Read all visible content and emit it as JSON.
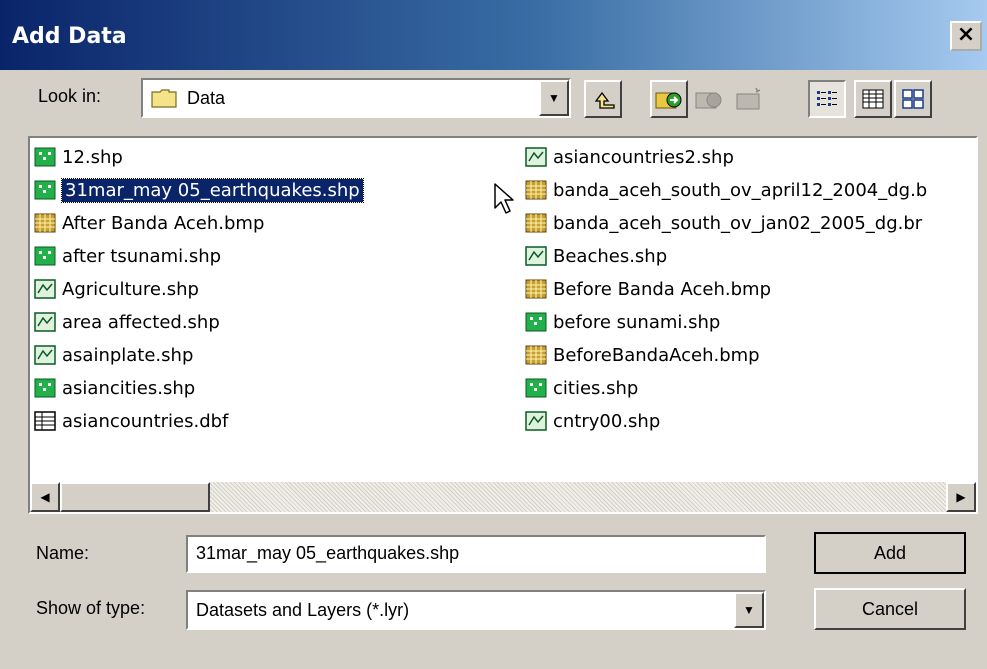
{
  "window": {
    "title": "Add Data",
    "close_label": "×"
  },
  "toolbar": {
    "lookin_label": "Look in:",
    "lookin_value": "Data",
    "icons": [
      "up-one-level-icon",
      "connect-to-folder-icon",
      "disconnect-folder-icon",
      "new-folder-icon",
      "list-view-icon",
      "details-view-icon",
      "thumbnails-view-icon"
    ]
  },
  "files": {
    "column1": [
      {
        "name": "12.shp",
        "type": "point"
      },
      {
        "name": "31mar_may 05_earthquakes.shp",
        "type": "point",
        "selected": true
      },
      {
        "name": "After Banda Aceh.bmp",
        "type": "raster"
      },
      {
        "name": "after tsunami.shp",
        "type": "point"
      },
      {
        "name": "Agriculture.shp",
        "type": "polygon"
      },
      {
        "name": "area affected.shp",
        "type": "polygon"
      },
      {
        "name": "asainplate.shp",
        "type": "polygon"
      },
      {
        "name": "asiancities.shp",
        "type": "point"
      },
      {
        "name": "asiancountries.dbf",
        "type": "table"
      }
    ],
    "column2": [
      {
        "name": "asiancountries2.shp",
        "type": "polygon"
      },
      {
        "name": "banda_aceh_south_ov_april12_2004_dg.b",
        "type": "raster"
      },
      {
        "name": "banda_aceh_south_ov_jan02_2005_dg.br",
        "type": "raster"
      },
      {
        "name": "Beaches.shp",
        "type": "polygon"
      },
      {
        "name": "Before Banda Aceh.bmp",
        "type": "raster"
      },
      {
        "name": "before sunami.shp",
        "type": "point"
      },
      {
        "name": "BeforeBandaAceh.bmp",
        "type": "raster"
      },
      {
        "name": "cities.shp",
        "type": "point"
      },
      {
        "name": "cntry00.shp",
        "type": "polygon"
      }
    ]
  },
  "form": {
    "name_label": "Name:",
    "name_value": "31mar_may 05_earthquakes.shp",
    "type_label": "Show of type:",
    "type_value": "Datasets and Layers (*.lyr)",
    "add_label": "Add",
    "cancel_label": "Cancel"
  },
  "colors": {
    "selection": "#0a246a",
    "dialog": "#d4d0c8",
    "title_start": "#0a246a",
    "title_end": "#a6caf0"
  }
}
